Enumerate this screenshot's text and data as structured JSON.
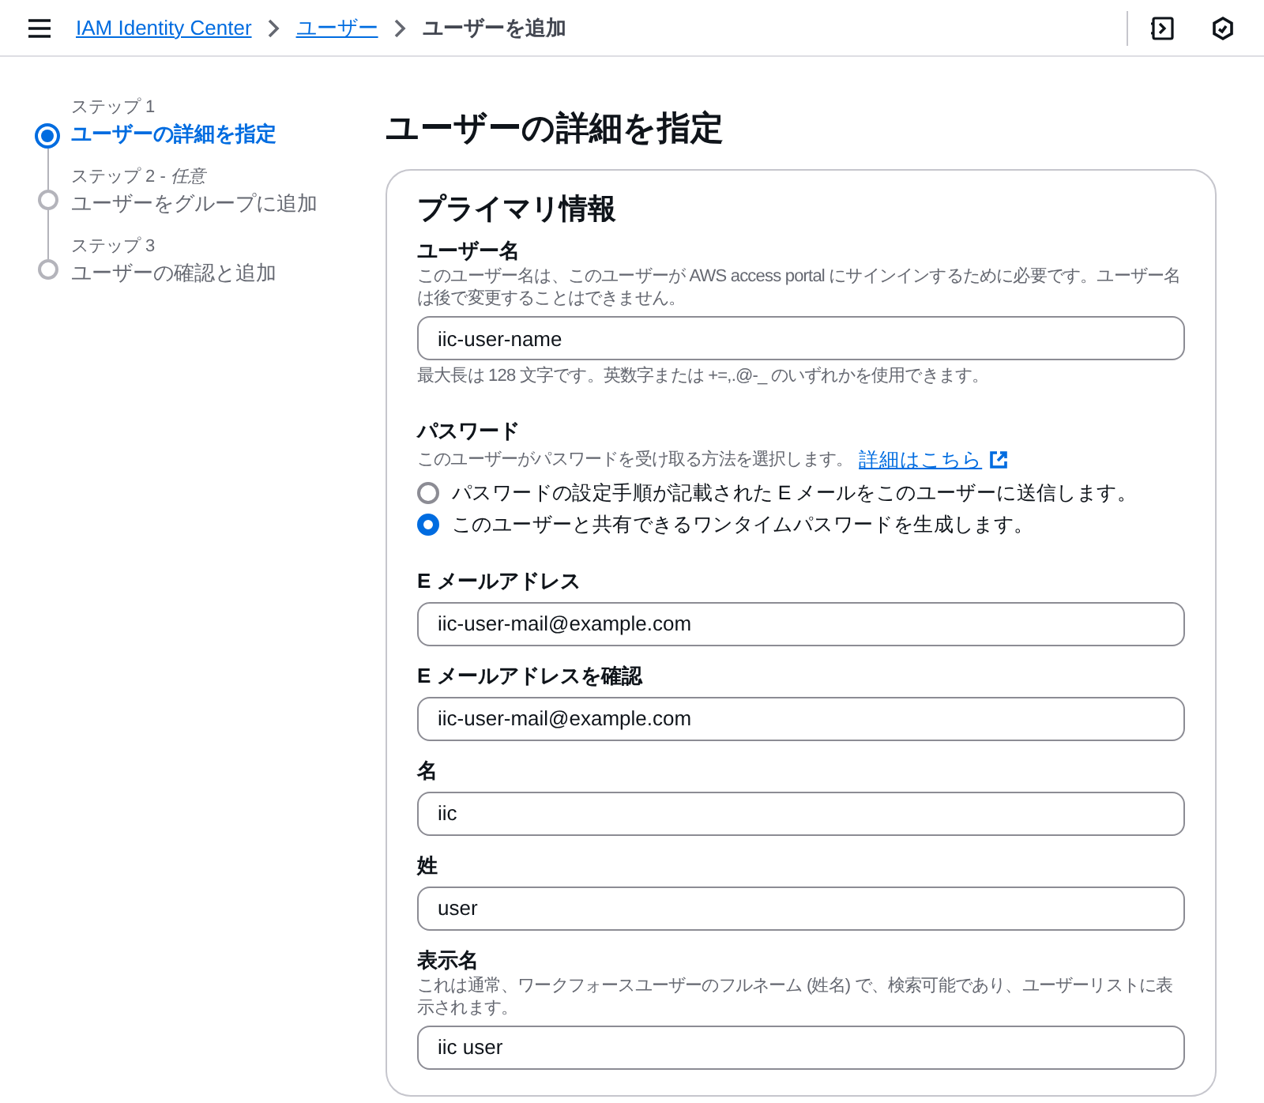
{
  "breadcrumbs": [
    {
      "label": "IAM Identity Center",
      "kind": "link"
    },
    {
      "label": "ユーザー",
      "kind": "link"
    },
    {
      "label": "ユーザーを追加",
      "kind": "current"
    }
  ],
  "steps": [
    {
      "step": "ステップ 1",
      "title": "ユーザーの詳細を指定",
      "selected": true
    },
    {
      "step": "ステップ 2 - ",
      "optional": "任意",
      "title": "ユーザーをグループに追加",
      "selected": false
    },
    {
      "step": "ステップ 3",
      "title": "ユーザーの確認と追加",
      "selected": false
    }
  ],
  "page_title": "ユーザーの詳細を指定",
  "card": {
    "title": "プライマリ情報",
    "fields": [
      {
        "kind": "text",
        "label": "ユーザー名",
        "description": "このユーザー名は、このユーザーが AWS access portal にサインインするために必要です。ユーザー名は後で変更することはできません。",
        "value": "iic-user-name",
        "constraint": "最大長は 128 文字です。英数字または +=,.@-_ のいずれかを使用できます。"
      },
      {
        "kind": "radio",
        "label": "パスワード",
        "description": "このユーザーがパスワードを受け取る方法を選択します。",
        "link": "詳細はこちら",
        "options": [
          {
            "label": "パスワードの設定手順が記載された E メールをこのユーザーに送信します。",
            "selected": false
          },
          {
            "label": "このユーザーと共有できるワンタイムパスワードを生成します。",
            "selected": true
          }
        ]
      },
      {
        "kind": "text",
        "label": "E メールアドレス",
        "value": "iic-user-mail@example.com"
      },
      {
        "kind": "text",
        "label": "E メールアドレスを確認",
        "value": "iic-user-mail@example.com"
      },
      {
        "kind": "text",
        "label": "名",
        "value": "iic"
      },
      {
        "kind": "text",
        "label": "姓",
        "value": "user"
      },
      {
        "kind": "text",
        "label": "表示名",
        "description": "これは通常、ワークフォースユーザーのフルネーム (姓名) で、検索可能であり、ユーザーリストに表示されます。",
        "value": "iic user"
      }
    ]
  }
}
